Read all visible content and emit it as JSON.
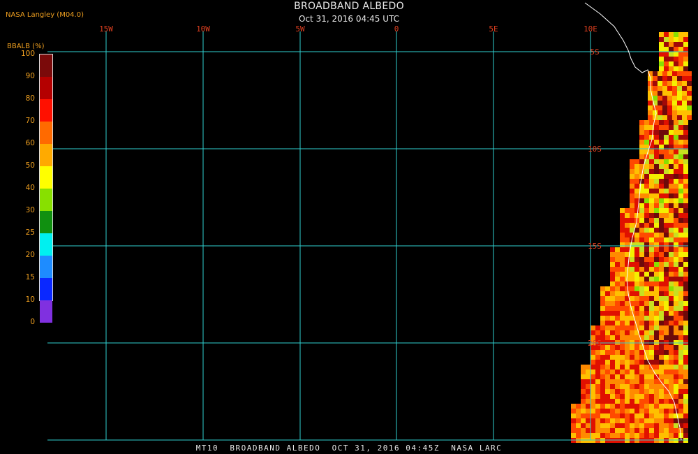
{
  "header": {
    "credit": "NASA Langley (M04.0)",
    "title": "BROADBAND ALBEDO",
    "subtitle": "Oct 31, 2016 04:45 UTC"
  },
  "legend": {
    "title": "BBALB (%)",
    "stops": [
      {
        "label": "100",
        "color": "#7a0a0a"
      },
      {
        "label": "90",
        "color": "#b40000"
      },
      {
        "label": "80",
        "color": "#ff1000"
      },
      {
        "label": "70",
        "color": "#ff6a00"
      },
      {
        "label": "60",
        "color": "#ffaa00"
      },
      {
        "label": "50",
        "color": "#ffff00"
      },
      {
        "label": "40",
        "color": "#88e000"
      },
      {
        "label": "30",
        "color": "#109010"
      },
      {
        "label": "25",
        "color": "#00f0f0"
      },
      {
        "label": "20",
        "color": "#1e8cff"
      },
      {
        "label": "15",
        "color": "#0a28ff"
      },
      {
        "label": "10",
        "color": "#8030e0"
      },
      {
        "label": "0",
        "color": ""
      }
    ]
  },
  "map": {
    "longitude_labels": [
      "15W",
      "10W",
      "5W",
      "0",
      "5E",
      "10E"
    ],
    "latitude_labels": [
      "5S",
      "10S",
      "15S",
      "20S"
    ],
    "grid_color": "#30d0d0",
    "label_color": "#e04020",
    "coastline_color": "#ffffff"
  },
  "footer": {
    "text": "MT10  BROADBAND ALBEDO  OCT 31, 2016 04:45Z  NASA LARC"
  }
}
